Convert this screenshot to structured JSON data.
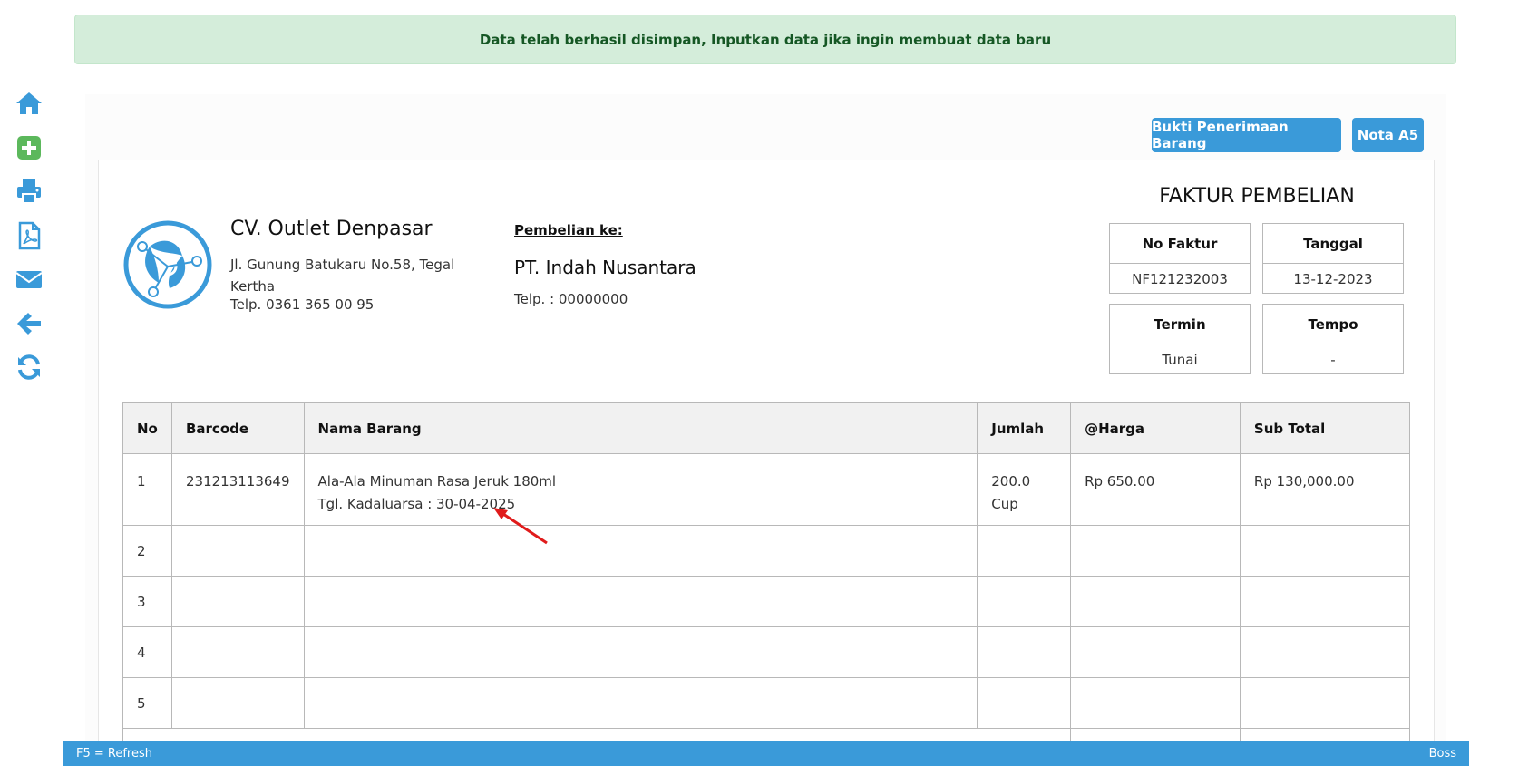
{
  "alert": {
    "message": "Data telah berhasil disimpan, Inputkan data jika ingin membuat data baru"
  },
  "sidebar": {
    "icons": [
      "home-icon",
      "plus-square-icon",
      "print-icon",
      "pdf-file-icon",
      "envelope-icon",
      "arrow-left-icon",
      "refresh-icon"
    ]
  },
  "buttons": {
    "bukti": "Bukti Penerimaan Barang",
    "nota": "Nota A5"
  },
  "company": {
    "name": "CV. Outlet Denpasar",
    "address": "Jl. Gunung Batukaru No.58, Tegal Kertha",
    "phone": "Telp. 0361 365 00 95"
  },
  "supplier": {
    "label": "Pembelian ke:",
    "name": "PT. Indah Nusantara",
    "phone": "Telp. : 00000000"
  },
  "invoice": {
    "title": "FAKTUR PEMBELIAN",
    "no_faktur_label": "No Faktur",
    "no_faktur": "NF121232003",
    "tanggal_label": "Tanggal",
    "tanggal": "13-12-2023",
    "termin_label": "Termin",
    "termin": "Tunai",
    "tempo_label": "Tempo",
    "tempo": "-"
  },
  "table": {
    "headers": {
      "no": "No",
      "barcode": "Barcode",
      "nama": "Nama Barang",
      "jumlah": "Jumlah",
      "harga": "@Harga",
      "subtotal": "Sub Total"
    },
    "row1": {
      "no": "1",
      "barcode": "231213113649",
      "nama": "Ala-Ala Minuman Rasa Jeruk 180ml",
      "expiry": "Tgl. Kadaluarsa : 30-04-2025",
      "jumlah": "200.0 Cup",
      "harga": "Rp 650.00",
      "subtotal": "Rp 130,000.00"
    },
    "empty_rows": [
      "2",
      "3",
      "4",
      "5"
    ]
  },
  "colors": {
    "accent": "#3a9ad9",
    "alert_bg": "#d4edda",
    "alert_text": "#155724",
    "arrow": "#e01b1b"
  },
  "footer": {
    "left": "F5 = Refresh",
    "right": "Boss"
  }
}
